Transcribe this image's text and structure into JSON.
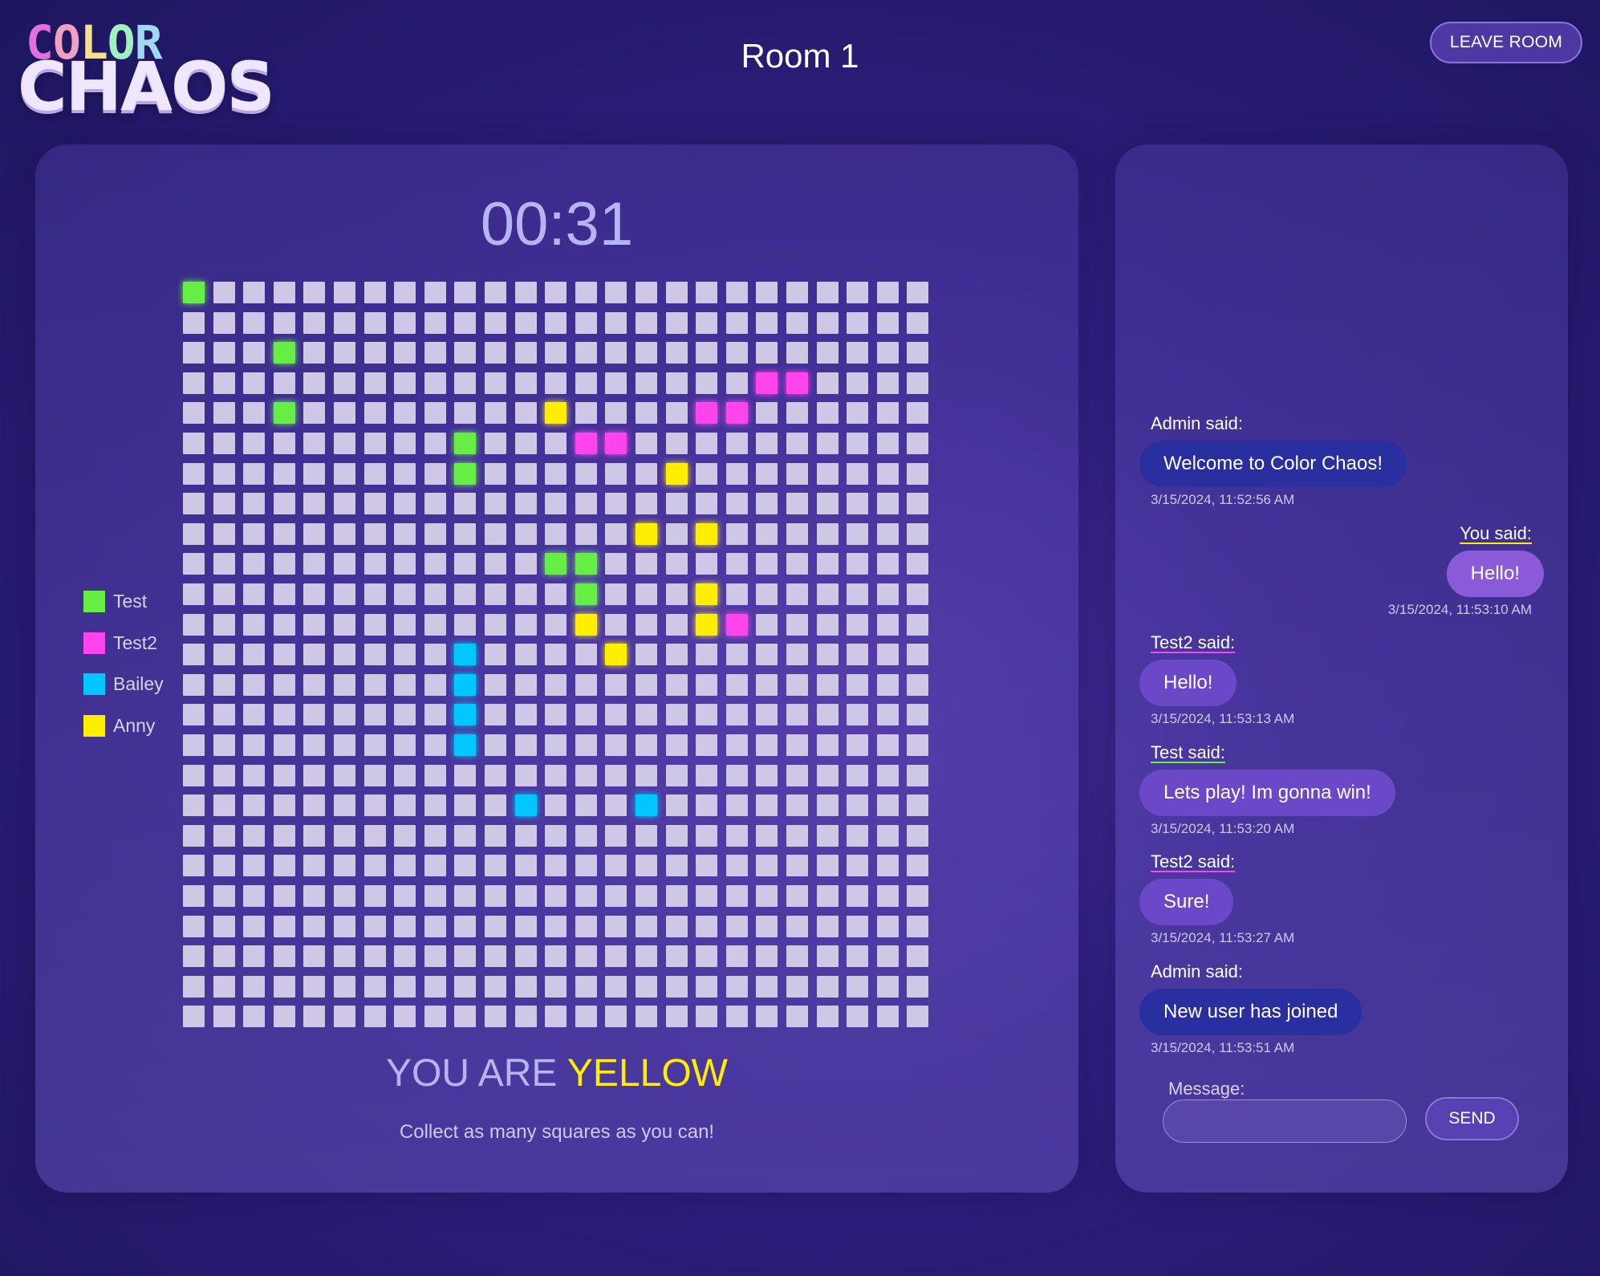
{
  "header": {
    "logo_top": "COLOR",
    "logo_bottom": "CHAOS",
    "room_title": "Room 1",
    "leave_button": "LEAVE ROOM"
  },
  "game": {
    "timer": "00:31",
    "you_are_prefix": "YOU ARE",
    "you_are_color": "YELLOW",
    "instruction": "Collect as many squares as you can!",
    "grid": {
      "rows": 25,
      "cols": 25,
      "empty_color": "#cfc7e6"
    },
    "players": [
      {
        "name": "Test",
        "color": "#66ee44"
      },
      {
        "name": "Test2",
        "color": "#ff44ee"
      },
      {
        "name": "Bailey",
        "color": "#00c8ff"
      },
      {
        "name": "Anny",
        "color": "#ffee00"
      }
    ],
    "claimed_cells": [
      {
        "row": 0,
        "col": 0,
        "player": "Test"
      },
      {
        "row": 2,
        "col": 3,
        "player": "Test"
      },
      {
        "row": 4,
        "col": 3,
        "player": "Test"
      },
      {
        "row": 5,
        "col": 9,
        "player": "Test"
      },
      {
        "row": 6,
        "col": 9,
        "player": "Test"
      },
      {
        "row": 9,
        "col": 12,
        "player": "Test"
      },
      {
        "row": 9,
        "col": 13,
        "player": "Test"
      },
      {
        "row": 10,
        "col": 13,
        "player": "Test"
      },
      {
        "row": 3,
        "col": 19,
        "player": "Test2"
      },
      {
        "row": 3,
        "col": 20,
        "player": "Test2"
      },
      {
        "row": 4,
        "col": 17,
        "player": "Test2"
      },
      {
        "row": 4,
        "col": 18,
        "player": "Test2"
      },
      {
        "row": 5,
        "col": 13,
        "player": "Test2"
      },
      {
        "row": 5,
        "col": 14,
        "player": "Test2"
      },
      {
        "row": 11,
        "col": 18,
        "player": "Test2"
      },
      {
        "row": 4,
        "col": 12,
        "player": "Anny"
      },
      {
        "row": 6,
        "col": 16,
        "player": "Anny"
      },
      {
        "row": 8,
        "col": 15,
        "player": "Anny"
      },
      {
        "row": 8,
        "col": 17,
        "player": "Anny"
      },
      {
        "row": 10,
        "col": 17,
        "player": "Anny"
      },
      {
        "row": 11,
        "col": 13,
        "player": "Anny"
      },
      {
        "row": 11,
        "col": 17,
        "player": "Anny"
      },
      {
        "row": 12,
        "col": 14,
        "player": "Anny"
      },
      {
        "row": 12,
        "col": 9,
        "player": "Bailey"
      },
      {
        "row": 13,
        "col": 9,
        "player": "Bailey"
      },
      {
        "row": 14,
        "col": 9,
        "player": "Bailey"
      },
      {
        "row": 15,
        "col": 9,
        "player": "Bailey"
      },
      {
        "row": 17,
        "col": 11,
        "player": "Bailey"
      },
      {
        "row": 17,
        "col": 15,
        "player": "Bailey"
      }
    ]
  },
  "chat": {
    "messages": [
      {
        "sender": "Admin said:",
        "text": "Welcome to Color Chaos!",
        "time": "3/15/2024, 11:52:56 AM",
        "kind": "admin",
        "align": "left",
        "underline": ""
      },
      {
        "sender": "You said:",
        "text": "Hello!",
        "time": "3/15/2024, 11:53:10 AM",
        "kind": "me",
        "align": "right",
        "underline": "#ffee00"
      },
      {
        "sender": "Test2 said:",
        "text": "Hello!",
        "time": "3/15/2024, 11:53:13 AM",
        "kind": "user",
        "align": "left",
        "underline": "#ff44ee"
      },
      {
        "sender": "Test said:",
        "text": "Lets play! Im gonna win!",
        "time": "3/15/2024, 11:53:20 AM",
        "kind": "user",
        "align": "left",
        "underline": "#66ee44"
      },
      {
        "sender": "Test2 said:",
        "text": "Sure!",
        "time": "3/15/2024, 11:53:27 AM",
        "kind": "user",
        "align": "left",
        "underline": "#ff44ee"
      },
      {
        "sender": "Admin said:",
        "text": "New user has joined",
        "time": "3/15/2024, 11:53:51 AM",
        "kind": "admin",
        "align": "left",
        "underline": ""
      }
    ],
    "input_label": "Message:",
    "input_value": "",
    "send_button": "SEND"
  }
}
